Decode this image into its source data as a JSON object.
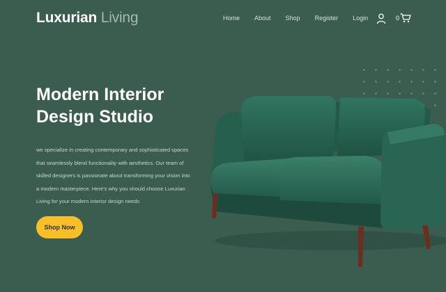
{
  "brand": {
    "part1": "Luxurian",
    "part2": "Living"
  },
  "nav": {
    "items": [
      "Home",
      "About",
      "Shop",
      "Register",
      "Login"
    ]
  },
  "cart": {
    "count": "0"
  },
  "hero": {
    "title": "Modern Interior Design Studio",
    "description": "we specialize in creating contemporary and sophisticated spaces that seamlessly blend functionality with aesthetics. Our team of skilled designers is passionate about transforming your vision into a modern masterpiece. Here's why you should choose Luxurian Living for your modern interior design needs",
    "button": "Shop Now"
  },
  "colors": {
    "background": "#3b5d50",
    "accent": "#f9bf29",
    "sofa": "#2f6a55"
  },
  "icons": {
    "user": "user-icon",
    "cart": "cart-icon"
  }
}
